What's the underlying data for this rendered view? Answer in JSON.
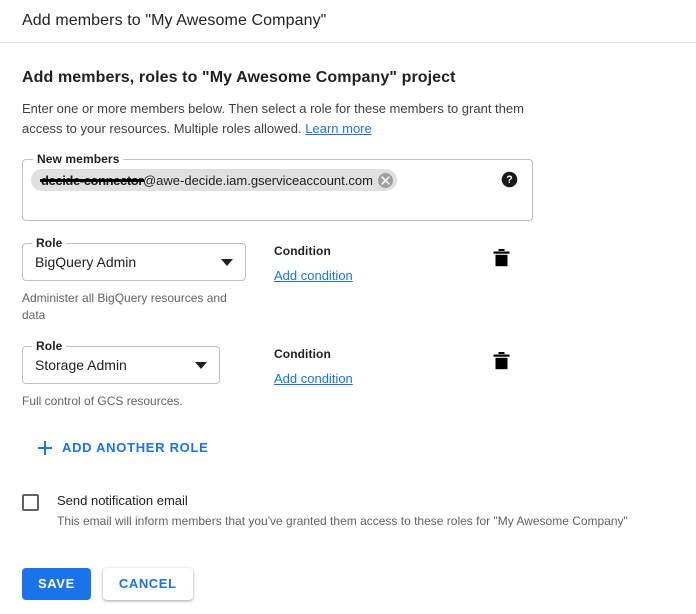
{
  "window": {
    "title": "Add members to \"My Awesome Company\""
  },
  "page": {
    "heading": "Add members, roles to \"My Awesome Company\" project",
    "description": "Enter one or more members below. Then select a role for these members to grant them access to your resources. Multiple roles allowed.",
    "learn_more_label": "Learn more"
  },
  "members_field": {
    "legend": "New members",
    "chip": {
      "redacted_text": "decide-connector",
      "domain_text": "@awe-decide.iam.gserviceaccount.com",
      "remove_icon": "close-icon"
    },
    "help_icon": "help-circle-icon"
  },
  "roles": [
    {
      "label": "Role",
      "value": "BigQuery Admin",
      "description": "Administer all BigQuery resources and data",
      "condition_label": "Condition",
      "add_condition_label": "Add condition",
      "delete_icon": "trash-icon"
    },
    {
      "label": "Role",
      "value": "Storage Admin",
      "description": "Full control of GCS resources.",
      "condition_label": "Condition",
      "add_condition_label": "Add condition",
      "delete_icon": "trash-icon"
    }
  ],
  "add_role": {
    "label": "ADD ANOTHER ROLE",
    "icon": "plus-icon"
  },
  "notification": {
    "checkbox_label": "Send notification email",
    "checked": false,
    "sub_text": "This email will inform members that you've granted them access to these roles for \"My Awesome Company\""
  },
  "actions": {
    "save_label": "SAVE",
    "cancel_label": "CANCEL"
  },
  "colors": {
    "accent": "#1a73e8",
    "text_primary": "#202124",
    "text_secondary": "#5f6368",
    "border": "#bdc1c6",
    "chip_bg": "#e0e0e0"
  }
}
